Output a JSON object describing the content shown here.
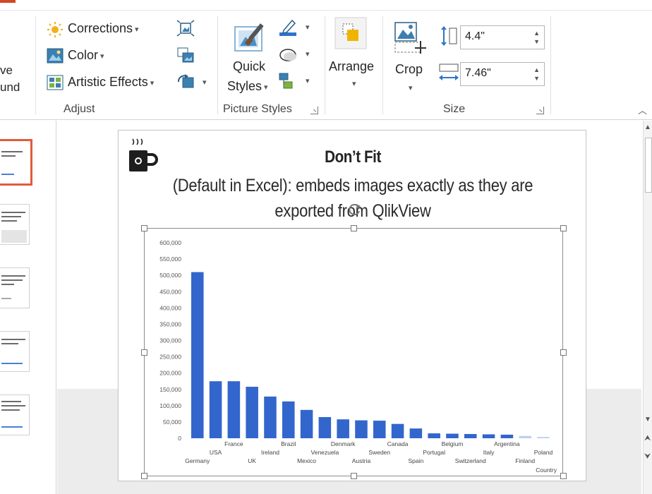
{
  "ribbon": {
    "partial_label_line1": "ve",
    "partial_label_line2": "und",
    "adjust": {
      "corrections_label": "Corrections",
      "color_label": "Color",
      "artistic_label": "Artistic Effects",
      "group_label": "Adjust"
    },
    "picture_styles": {
      "quick_styles_line1": "Quick",
      "quick_styles_line2": "Styles",
      "group_label": "Picture Styles"
    },
    "arrange": {
      "label": "Arrange"
    },
    "size": {
      "crop_label": "Crop",
      "height_value": "4.4\"",
      "width_value": "7.46\"",
      "group_label": "Size"
    }
  },
  "slide": {
    "title": "Don’t Fit",
    "subtitle_line1": "(Default in Excel): embeds images exactly as they are",
    "subtitle_line2": "exported from QlikView"
  },
  "colors": {
    "accent": "#d24726",
    "bar": "#3366cc",
    "selection": "#e25b3c"
  },
  "chart_data": {
    "type": "bar",
    "title": "",
    "xlabel": "Country",
    "ylabel": "",
    "ylim": [
      0,
      600000
    ],
    "ytick_labels": [
      "0",
      "50,000",
      "100,000",
      "150,000",
      "200,000",
      "250,000",
      "300,000",
      "350,000",
      "400,000",
      "450,000",
      "500,000",
      "550,000",
      "600,000"
    ],
    "categories": [
      "Germany",
      "USA",
      "France",
      "UK",
      "Ireland",
      "Brazil",
      "Mexico",
      "Venezuela",
      "Denmark",
      "Austria",
      "Sweden",
      "Canada",
      "Spain",
      "Portugal",
      "Belgium",
      "Switzerland",
      "Italy",
      "Argentina",
      "Finland",
      "Poland"
    ],
    "values": [
      510000,
      175000,
      175000,
      158000,
      128000,
      113000,
      87000,
      65000,
      58000,
      55000,
      54000,
      44000,
      30000,
      15000,
      14000,
      13000,
      12000,
      11000,
      7000,
      4000
    ]
  }
}
